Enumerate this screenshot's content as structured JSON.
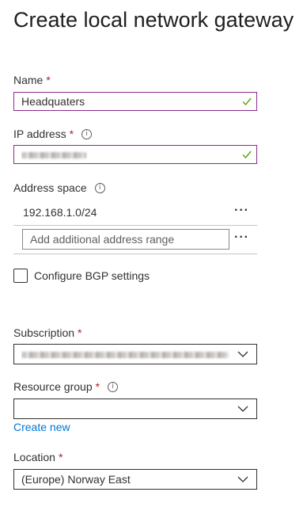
{
  "page": {
    "title": "Create local network gateway"
  },
  "name_field": {
    "label": "Name",
    "value": "Headquaters"
  },
  "ip_field": {
    "label": "IP address"
  },
  "address_space": {
    "label": "Address space",
    "ranges": [
      "192.168.1.0/24"
    ],
    "add_placeholder": "Add additional address range"
  },
  "bgp": {
    "label": "Configure BGP settings",
    "checked": false
  },
  "subscription": {
    "label": "Subscription"
  },
  "resource_group": {
    "label": "Resource group",
    "value": "",
    "create_new": "Create new"
  },
  "location": {
    "label": "Location",
    "value": "(Europe) Norway East"
  },
  "icons": {
    "info": "info-circle-icon",
    "valid": "checkmark-icon",
    "chevron": "chevron-down-icon",
    "more": "more-ellipsis-icon"
  },
  "colors": {
    "required": "#a4262c",
    "valid_border": "#8a2b8f",
    "valid_check": "#57a300",
    "link": "#0078d4"
  }
}
